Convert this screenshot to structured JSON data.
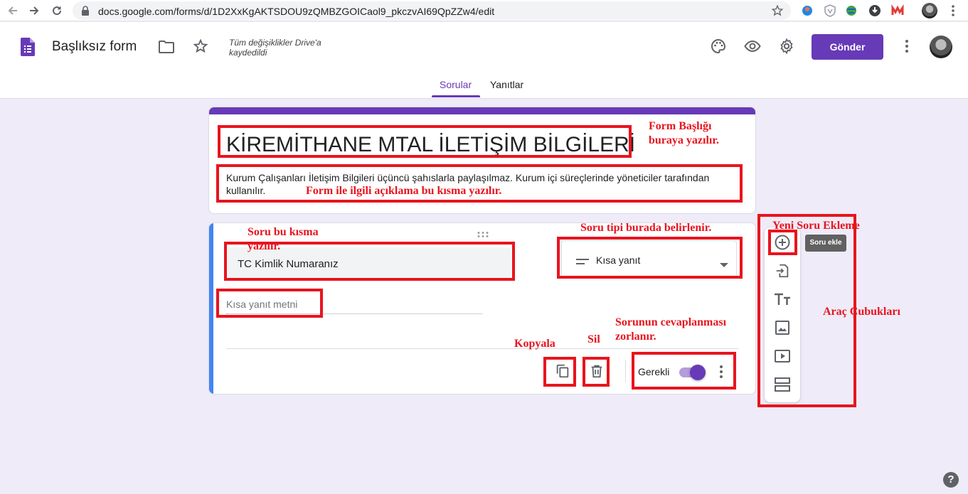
{
  "browser": {
    "url": "docs.google.com/forms/d/1D2XxKgAKTSDOU9zQMBZGOICaol9_pkczvAI69QpZZw4/edit"
  },
  "header": {
    "title": "Başlıksız form",
    "save_status": "Tüm değişiklikler Drive'a kaydedildi",
    "send_label": "Gönder",
    "tabs": [
      {
        "label": "Sorular",
        "active": true
      },
      {
        "label": "Yanıtlar",
        "active": false
      }
    ]
  },
  "form": {
    "title": "KİREMİTHANE MTAL İLETİŞİM BİLGİLERİ",
    "description": "Kurum Çalışanları İletişim Bilgileri üçüncü şahıslarla paylaşılmaz. Kurum içi süreçlerinde yöneticiler tarafından kullanılır."
  },
  "question": {
    "text": "TC Kimlik Numaranız",
    "type_label": "Kısa yanıt",
    "answer_placeholder": "Kısa yanıt metni",
    "required_label": "Gerekli",
    "required": true
  },
  "toolbar": {
    "tooltip": "Soru ekle"
  },
  "annotations": {
    "form_title_note": "Form Başlığı buraya yazılır.",
    "form_desc_note": "Form ile ilgili açıklama bu kısma yazılır.",
    "question_note": "Soru bu kısma yazılır.",
    "type_note": "Soru tipi burada belirlenir.",
    "add_note": "Yeni Soru Ekleme",
    "toolbar_note": "Araç Çubukları",
    "required_note": "Sorunun cevaplanması zorlanır.",
    "copy_note": "Kopyala",
    "delete_note": "Sil"
  },
  "colors": {
    "accent": "#673ab7",
    "annotation": "#e8141e",
    "question_bar": "#4285f4",
    "background": "#efebf8"
  },
  "help_symbol": "?"
}
